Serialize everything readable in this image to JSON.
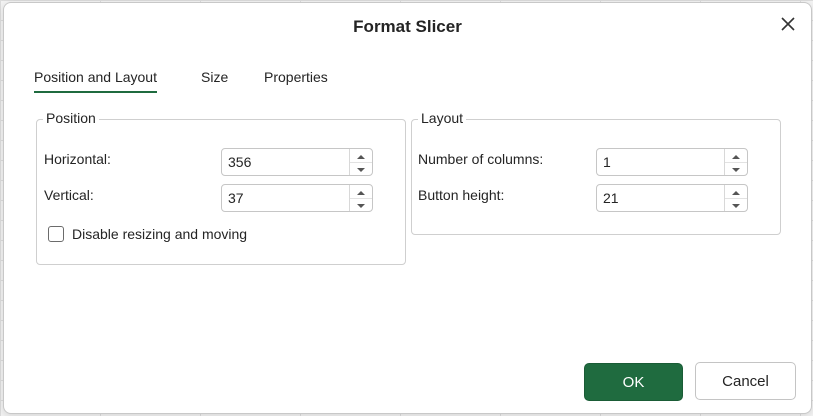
{
  "dialog": {
    "title": "Format Slicer",
    "close_icon": "close-icon"
  },
  "tabs": [
    {
      "label": "Position and Layout",
      "active": true
    },
    {
      "label": "Size",
      "active": false
    },
    {
      "label": "Properties",
      "active": false
    }
  ],
  "position": {
    "legend": "Position",
    "horizontal_label": "Horizontal:",
    "horizontal_value": "356",
    "vertical_label": "Vertical:",
    "vertical_value": "37",
    "disable_label": "Disable resizing and moving",
    "disable_checked": false
  },
  "layout": {
    "legend": "Layout",
    "columns_label": "Number of columns:",
    "columns_value": "1",
    "button_height_label": "Button height:",
    "button_height_value": "21"
  },
  "buttons": {
    "ok_label": "OK",
    "cancel_label": "Cancel"
  },
  "colors": {
    "accent": "#1f6b3f"
  }
}
